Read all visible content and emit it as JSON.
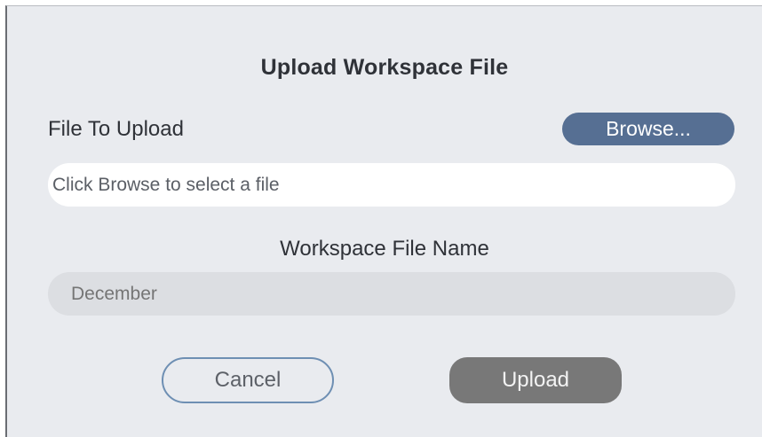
{
  "dialog": {
    "title": "Upload Workspace File",
    "file_label": "File To Upload",
    "browse_label": "Browse...",
    "file_input": {
      "value": "",
      "placeholder": "Click Browse to select a file"
    },
    "name_label": "Workspace File Name",
    "name_input": {
      "value": "",
      "placeholder": "December"
    },
    "cancel_label": "Cancel",
    "upload_label": "Upload"
  },
  "colors": {
    "dialog_background": "#e9ebef",
    "browse_button": "#566f93",
    "upload_button_disabled": "#787878",
    "cancel_border": "#6e8fb3"
  }
}
